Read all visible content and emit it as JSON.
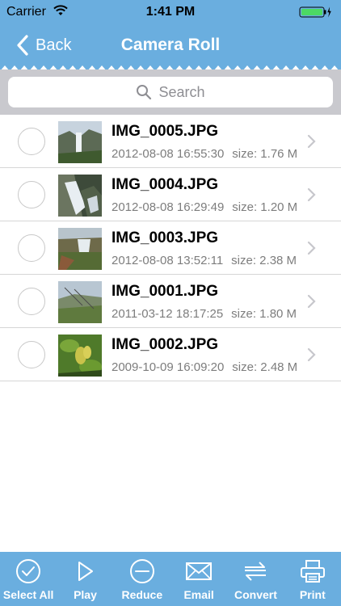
{
  "status_bar": {
    "carrier": "Carrier",
    "time": "1:41 PM"
  },
  "nav": {
    "back_label": "Back",
    "title": "Camera Roll"
  },
  "search": {
    "placeholder": "Search"
  },
  "files": [
    {
      "name": "IMG_0005.JPG",
      "date": "2012-08-08 16:55:30",
      "size": "size: 1.76 M",
      "thumbnail": "waterfall-cliff"
    },
    {
      "name": "IMG_0004.JPG",
      "date": "2012-08-08 16:29:49",
      "size": "size: 1.20 M",
      "thumbnail": "waterfall-rocks"
    },
    {
      "name": "IMG_0003.JPG",
      "date": "2012-08-08 13:52:11",
      "size": "size: 2.38 M",
      "thumbnail": "waterfall-valley"
    },
    {
      "name": "IMG_0001.JPG",
      "date": "2011-03-12 18:17:25",
      "size": "size: 1.80 M",
      "thumbnail": "hillside-field"
    },
    {
      "name": "IMG_0002.JPG",
      "date": "2009-10-09 16:09:20",
      "size": "size: 2.48 M",
      "thumbnail": "green-leaves"
    }
  ],
  "toolbar": {
    "select_all": "Select All",
    "play": "Play",
    "reduce": "Reduce",
    "email": "Email",
    "convert": "Convert",
    "print": "Print"
  },
  "colors": {
    "accent": "#6aaedf",
    "battery": "#4cd964"
  }
}
